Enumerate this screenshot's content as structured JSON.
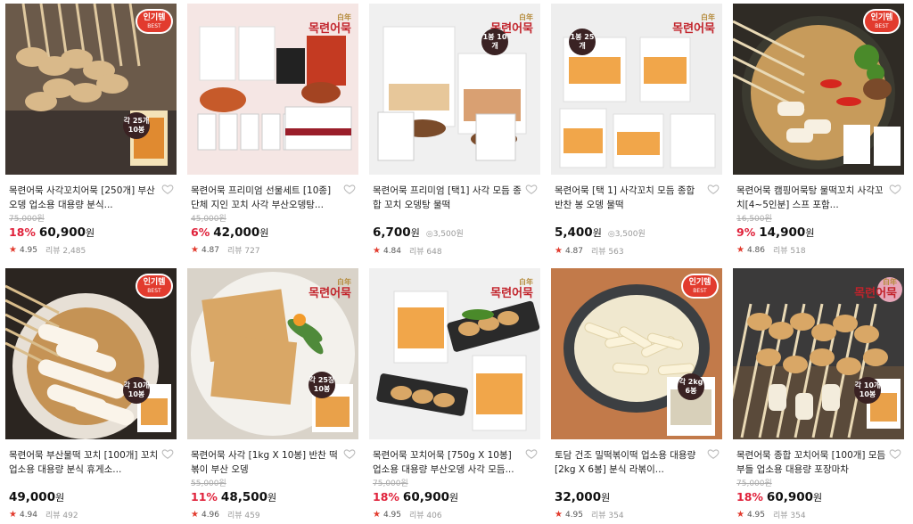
{
  "products": [
    {
      "title": "목련어묵 사각꼬치어묵 [250개] 부산오뎅 업소용 대용량 분식...",
      "orig": "75,000원",
      "discount": "18%",
      "price": "60,900",
      "unit": "원",
      "per": "",
      "rating": "4.95",
      "reviews": "리뷰 2,485",
      "badge": "인기템",
      "pack": "각 25개 10봉"
    },
    {
      "title": "목련어묵 프리미엄 선물세트 [10종] 단체 지인 꼬치 사각 부산오뎅탕...",
      "orig": "45,000원",
      "discount": "6%",
      "price": "42,000",
      "unit": "원",
      "per": "",
      "rating": "4.87",
      "reviews": "리뷰 727",
      "badge": "",
      "pack": ""
    },
    {
      "title": "목련어묵 프리미엄 [택1] 사각 모듬 종합 꼬치 오뎅탕 물떡",
      "orig": "",
      "discount": "",
      "price": "6,700",
      "unit": "원",
      "per": "3,500원",
      "rating": "4.84",
      "reviews": "리뷰 648",
      "badge": "",
      "pack": "1봉 10개"
    },
    {
      "title": "목련어묵 [택 1] 사각꼬치 모듬 종합 반찬 봉 오뎅 물떡",
      "orig": "",
      "discount": "",
      "price": "5,400",
      "unit": "원",
      "per": "3,500원",
      "rating": "4.87",
      "reviews": "리뷰 563",
      "badge": "",
      "pack": "1봉 25개"
    },
    {
      "title": "목련어묵 캠핑어묵탕 물떡꼬치 사각꼬치[4~5인분] 스프 포함...",
      "orig": "16,500원",
      "discount": "9%",
      "price": "14,900",
      "unit": "원",
      "per": "",
      "rating": "4.86",
      "reviews": "리뷰 518",
      "badge": "인기템",
      "pack": ""
    },
    {
      "title": "목련어묵 부산물떡 꼬치 [100개] 꼬치 업소용 대용량 분식 휴게소...",
      "orig": "",
      "discount": "",
      "price": "49,000",
      "unit": "원",
      "per": "",
      "rating": "4.94",
      "reviews": "리뷰 492",
      "badge": "인기템",
      "pack": "각 10개 10봉"
    },
    {
      "title": "목련어묵 사각 [1kg X 10봉] 반찬 떡볶이 부산 오뎅",
      "orig": "55,000원",
      "discount": "11%",
      "price": "48,500",
      "unit": "원",
      "per": "",
      "rating": "4.96",
      "reviews": "리뷰 459",
      "badge": "",
      "pack": "각 25장 10봉"
    },
    {
      "title": "목련어묵 꼬치어묵 [750g X 10봉] 업소용 대용량 부산오뎅 사각 모듬...",
      "orig": "75,000원",
      "discount": "18%",
      "price": "60,900",
      "unit": "원",
      "per": "",
      "rating": "4.95",
      "reviews": "리뷰 406",
      "badge": "",
      "pack": ""
    },
    {
      "title": "토담 건조 밀떡볶이떡 업소용 대용량 [2kg X 6봉] 분식 라볶이...",
      "orig": "",
      "discount": "",
      "price": "32,000",
      "unit": "원",
      "per": "",
      "rating": "4.95",
      "reviews": "리뷰 354",
      "badge": "인기템",
      "pack": "각 2kg 6봉"
    },
    {
      "title": "목련어묵 종합 꼬치어묵 [100개] 모듬 부들 업소용 대용량 포장마차",
      "orig": "75,000원",
      "discount": "18%",
      "price": "60,900",
      "unit": "원",
      "per": "",
      "rating": "4.95",
      "reviews": "리뷰 354",
      "badge": "",
      "pack": "각 10개 10봉"
    }
  ],
  "badge_sub": "BEST",
  "brand": {
    "line1": "白年",
    "line2": "목련어묵"
  },
  "colors": {
    "accent": "#e0223b",
    "badge": "#e23b2e"
  }
}
